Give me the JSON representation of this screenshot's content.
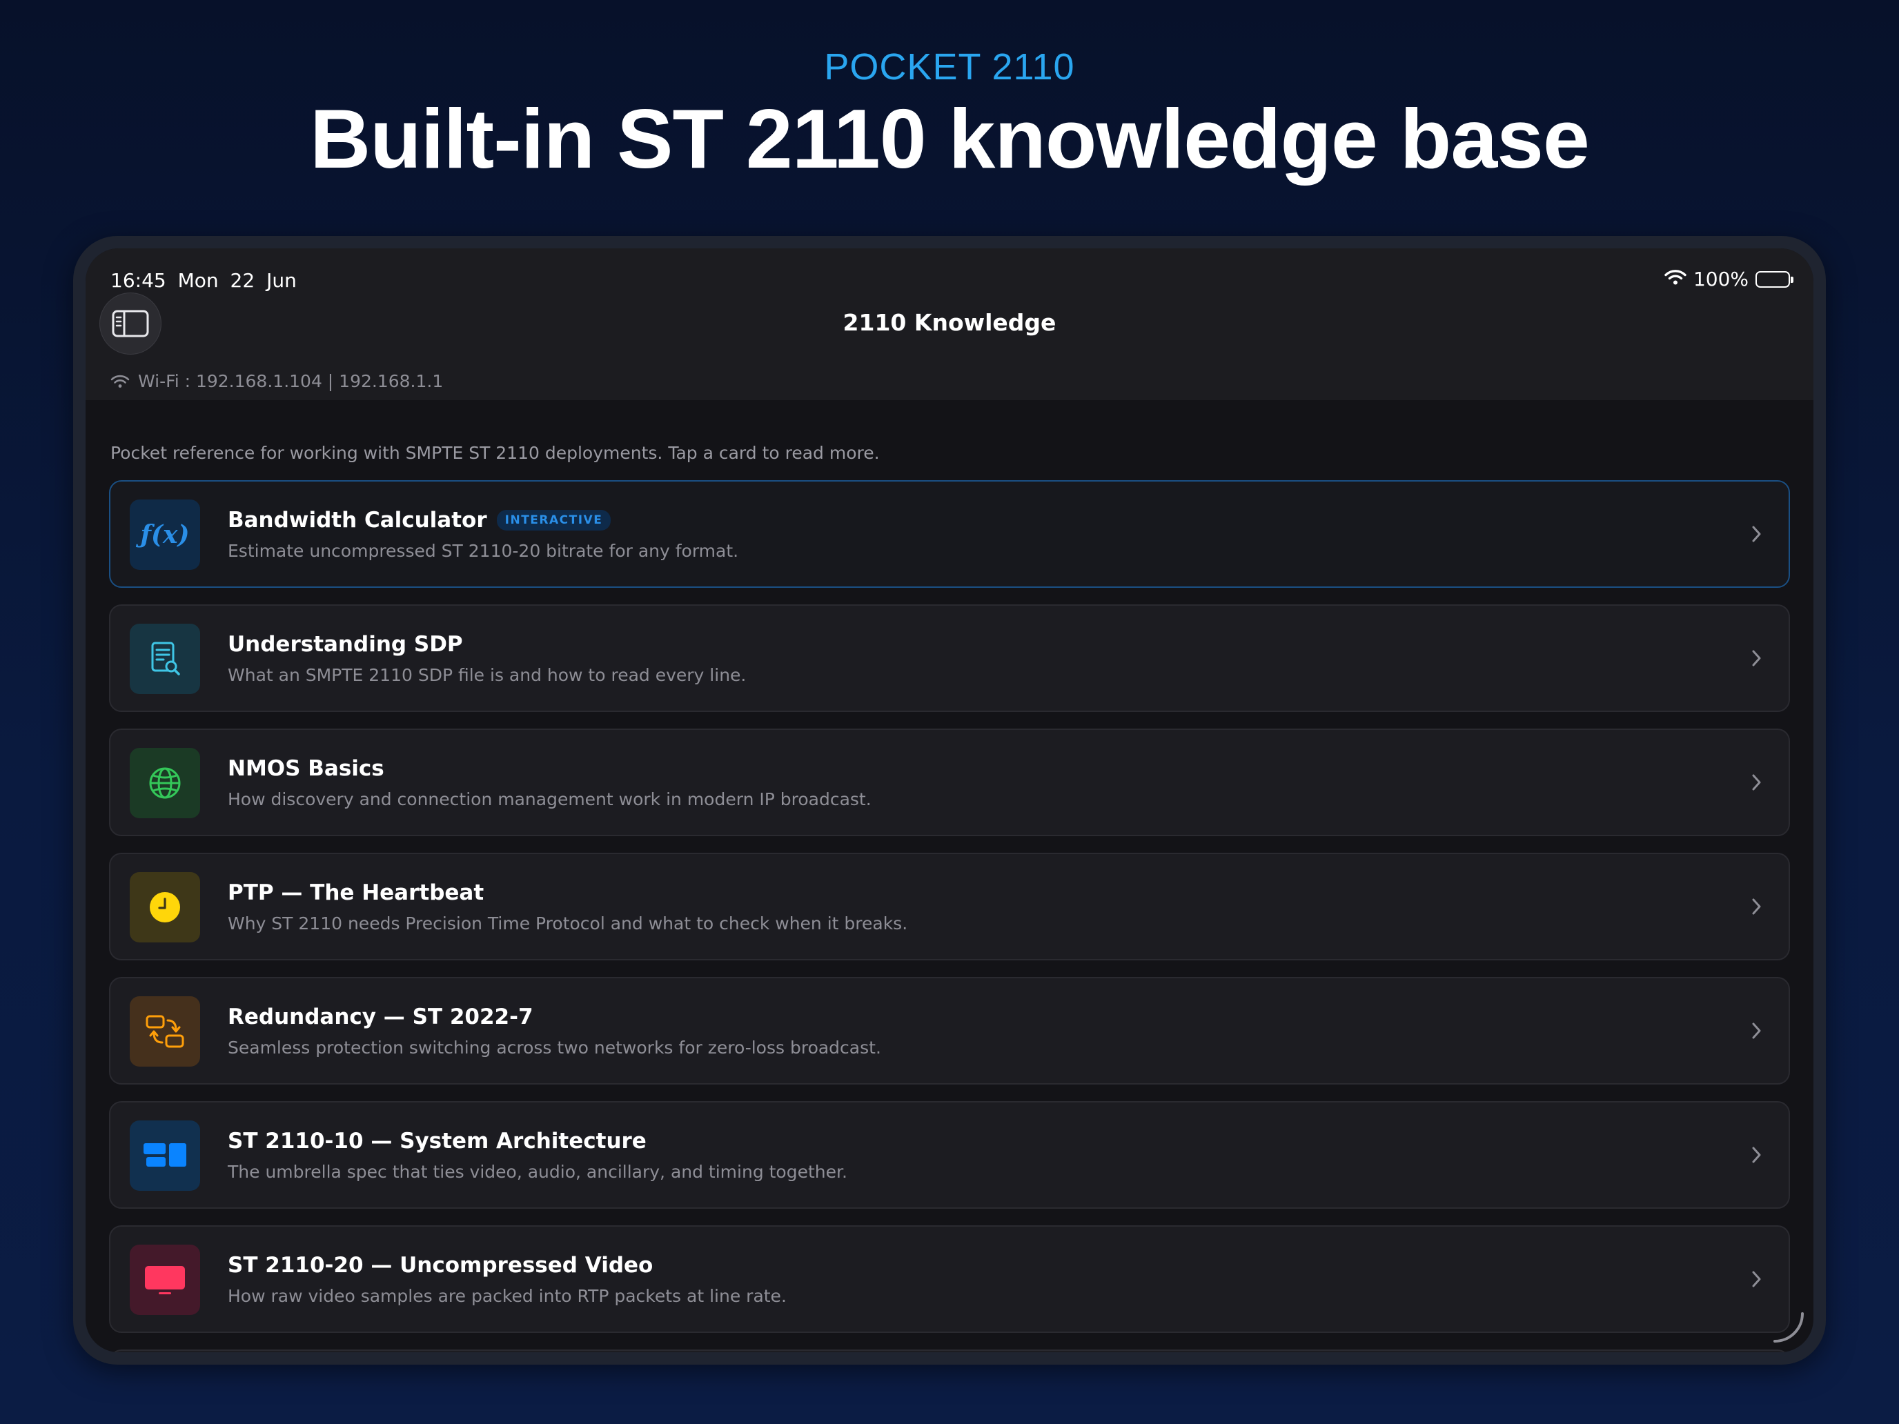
{
  "hero": {
    "brand": "POCKET 2110",
    "headline": "Built-in ST 2110 knowledge base"
  },
  "status_bar": {
    "time": "16:45",
    "date": "Mon 22 Jun",
    "battery": "100%",
    "battery_level": 1.0
  },
  "nav": {
    "title": "2110 Knowledge",
    "sidebar_icon": "sidebar-toggle-icon"
  },
  "network": {
    "label": "Wi-Fi : 192.168.1.104 | 192.168.1.1",
    "icon": "wifi-icon"
  },
  "intro": "Pocket reference for working with SMPTE ST 2110 deployments. Tap a card to read more.",
  "cards": [
    {
      "title": "Bandwidth Calculator",
      "badge": "INTERACTIVE",
      "subtitle": "Estimate uncompressed ST 2110-20 bitrate for any format.",
      "icon": "function-icon",
      "icon_text": "ƒ(x)",
      "icon_bg": "#0f2a47",
      "icon_color": "#2a8fe8"
    },
    {
      "title": "Understanding SDP",
      "subtitle": "What an SMPTE 2110 SDP file is and how to read every line.",
      "icon": "document-search-icon",
      "icon_bg": "#173542",
      "icon_color": "#3fc6e6"
    },
    {
      "title": "NMOS Basics",
      "subtitle": "How discovery and connection management work in modern IP broadcast.",
      "icon": "globe-icon",
      "icon_bg": "#1b3a25",
      "icon_color": "#34c759"
    },
    {
      "title": "PTP — The Heartbeat",
      "subtitle": "Why ST 2110 needs Precision Time Protocol and what to check when it breaks.",
      "icon": "clock-icon",
      "icon_bg": "#3e3718",
      "icon_color": "#ffd60a"
    },
    {
      "title": "Redundancy — ST 2022-7",
      "subtitle": "Seamless protection switching across two networks for zero-loss broadcast.",
      "icon": "swap-icon",
      "icon_bg": "#45301c",
      "icon_color": "#ff9f0a"
    },
    {
      "title": "ST 2110-10 — System Architecture",
      "subtitle": "The umbrella spec that ties video, audio, ancillary, and timing together.",
      "icon": "blocks-icon",
      "icon_bg": "#11304f",
      "icon_color": "#0a84ff"
    },
    {
      "title": "ST 2110-20 — Uncompressed Video",
      "subtitle": "How raw video samples are packed into RTP packets at line rate.",
      "icon": "display-icon",
      "icon_bg": "#44192a",
      "icon_color": "#ff375f"
    }
  ]
}
